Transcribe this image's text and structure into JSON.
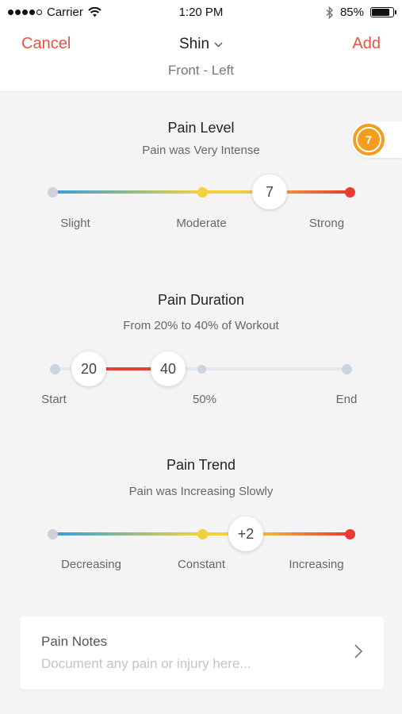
{
  "status_bar": {
    "carrier": "Carrier",
    "time": "1:20 PM",
    "battery": "85%",
    "battery_level": 0.85
  },
  "nav": {
    "cancel_label": "Cancel",
    "title": "Shin",
    "subtitle": "Front - Left",
    "add_label": "Add"
  },
  "badge": {
    "value": "7"
  },
  "pain_level": {
    "title": "Pain Level",
    "subtitle": "Pain was Very Intense",
    "value": "7",
    "labels": [
      "Slight",
      "Moderate",
      "Strong"
    ]
  },
  "pain_duration": {
    "title": "Pain Duration",
    "subtitle": "From 20% to 40% of Workout",
    "start_value": "20",
    "end_value": "40",
    "labels": [
      "Start",
      "50%",
      "End"
    ]
  },
  "pain_trend": {
    "title": "Pain Trend",
    "subtitle": "Pain was Increasing Slowly",
    "value": "+2",
    "labels": [
      "Decreasing",
      "Constant",
      "Increasing"
    ]
  },
  "notes": {
    "title": "Pain Notes",
    "placeholder": "Document any pain or injury here..."
  },
  "colors": {
    "accent": "#e9533f",
    "badge": "#f39c1e",
    "low": "#2f9fe0",
    "mid": "#f2d23c",
    "high": "#ea3a32"
  }
}
